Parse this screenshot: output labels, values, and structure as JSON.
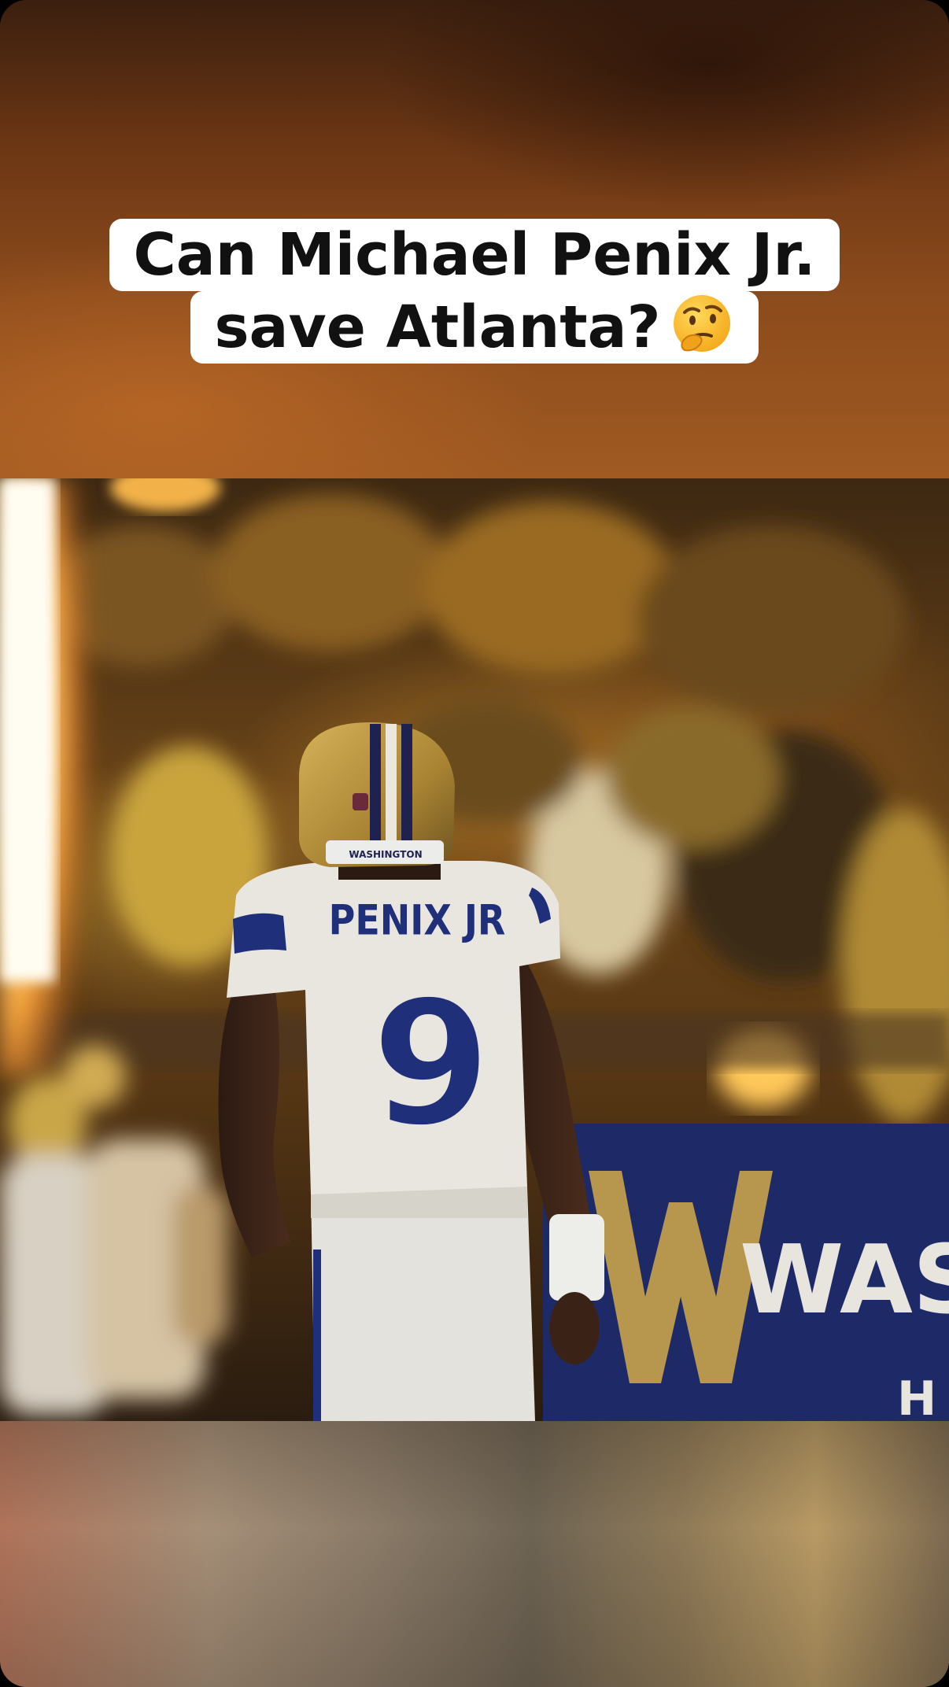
{
  "caption": {
    "line1": "Can Michael Penix Jr.",
    "line2": "save Atlanta?",
    "emoji": "thinking-face-icon"
  },
  "video": {
    "jersey_name": "PENIX JR",
    "jersey_number": "9",
    "helmet_text": "WASHINGTON",
    "banner_text": "WAS",
    "banner_sub": "H"
  },
  "colors": {
    "caption_bg": "#ffffff",
    "caption_text": "#111111",
    "jersey": "#e9e6e0",
    "jersey_accent": "#1f2f7a",
    "helmet_gold": "#b58f3e",
    "banner_navy": "#1e2a68"
  }
}
